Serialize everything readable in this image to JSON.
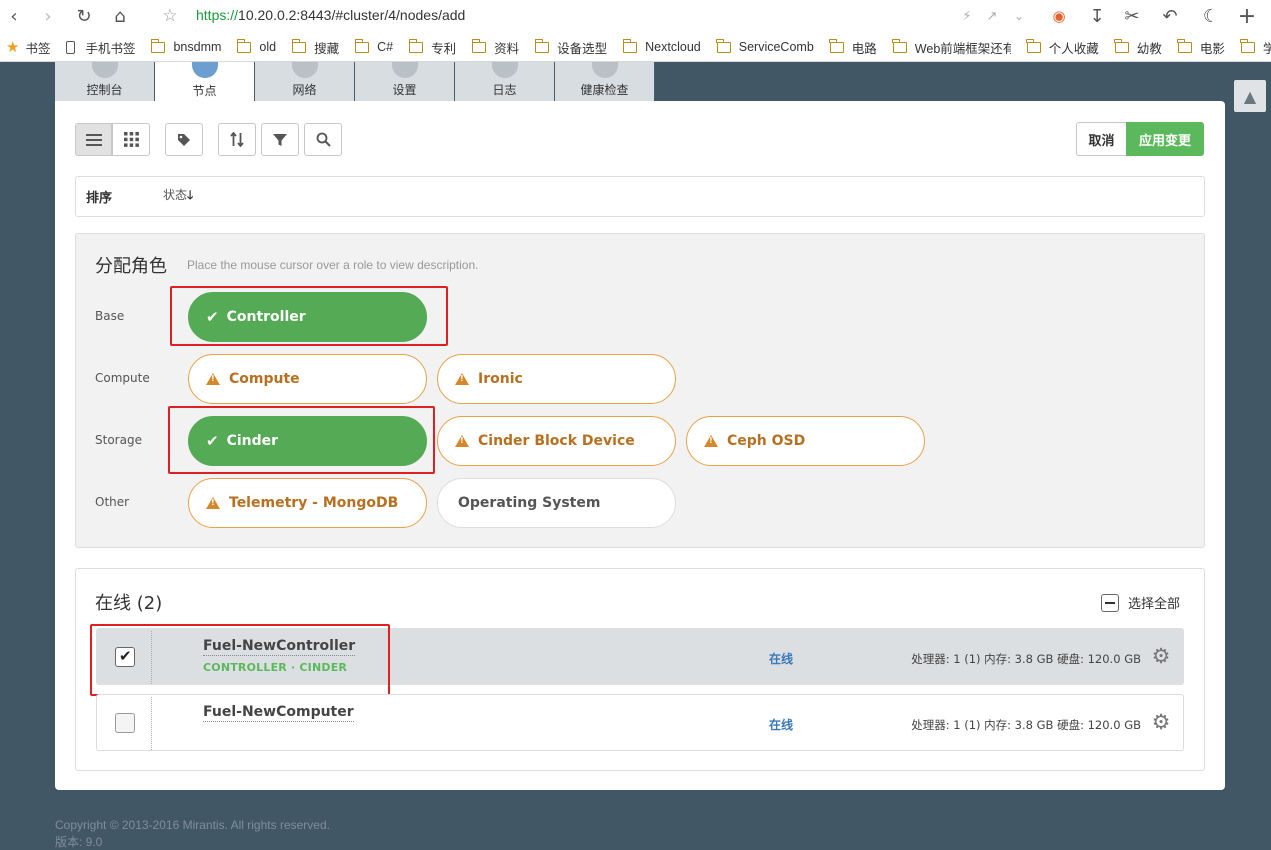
{
  "browser": {
    "url_scheme": "https://",
    "url_rest": "10.20.0.2:8443/#cluster/4/nodes/add",
    "bookmarks": [
      {
        "label": "书签"
      },
      {
        "label": "手机书签"
      },
      {
        "label": "bnsdmm"
      },
      {
        "label": "old"
      },
      {
        "label": "搜藏"
      },
      {
        "label": "C#"
      },
      {
        "label": "专利"
      },
      {
        "label": "资料"
      },
      {
        "label": "设备选型"
      },
      {
        "label": "Nextcloud"
      },
      {
        "label": "ServiceComb"
      },
      {
        "label": "电路"
      },
      {
        "label": "Web前端框架还有"
      },
      {
        "label": "个人收藏"
      },
      {
        "label": "幼教"
      },
      {
        "label": "电影"
      },
      {
        "label": "学习"
      }
    ]
  },
  "tabs": [
    {
      "label": "控制台",
      "icon": "dashboard-icon"
    },
    {
      "label": "节点",
      "icon": "cloud-icon"
    },
    {
      "label": "网络",
      "icon": "globe-icon"
    },
    {
      "label": "设置",
      "icon": "gear-icon"
    },
    {
      "label": "日志",
      "icon": "document-icon"
    },
    {
      "label": "健康检查",
      "icon": "heart-icon"
    }
  ],
  "toolbar": {
    "cancel_label": "取消",
    "apply_label": "应用变更"
  },
  "sort": {
    "title": "排序",
    "item": "状态",
    "direction_glyph": "🡓"
  },
  "roles": {
    "title": "分配角色",
    "hint": "Place the mouse cursor over a role to view description.",
    "groups": [
      {
        "label": "Base",
        "items": [
          {
            "name": "Controller",
            "state": "selected"
          }
        ]
      },
      {
        "label": "Compute",
        "items": [
          {
            "name": "Compute",
            "state": "warning"
          },
          {
            "name": "Ironic",
            "state": "warning"
          }
        ]
      },
      {
        "label": "Storage",
        "items": [
          {
            "name": "Cinder",
            "state": "selected"
          },
          {
            "name": "Cinder Block Device",
            "state": "warning"
          },
          {
            "name": "Ceph OSD",
            "state": "warning"
          }
        ]
      },
      {
        "label": "Other",
        "items": [
          {
            "name": "Telemetry - MongoDB",
            "state": "warning"
          },
          {
            "name": "Operating System",
            "state": "normal"
          }
        ]
      }
    ]
  },
  "nodes": {
    "title": "在线 (2)",
    "select_all_label": "选择全部",
    "items": [
      {
        "name": "Fuel-NewController",
        "roles": "CONTROLLER · CINDER",
        "status": "在线",
        "specs": "处理器: 1 (1)  内存: 3.8 GB  硬盘: 120.0 GB",
        "checked": true
      },
      {
        "name": "Fuel-NewComputer",
        "roles": "",
        "status": "在线",
        "specs": "处理器: 1 (1)  内存: 3.8 GB  硬盘: 120.0 GB",
        "checked": false
      }
    ]
  },
  "footer": {
    "copyright": "Copyright © 2013-2016 Mirantis. All rights reserved.",
    "version": "版本: 9.0"
  }
}
